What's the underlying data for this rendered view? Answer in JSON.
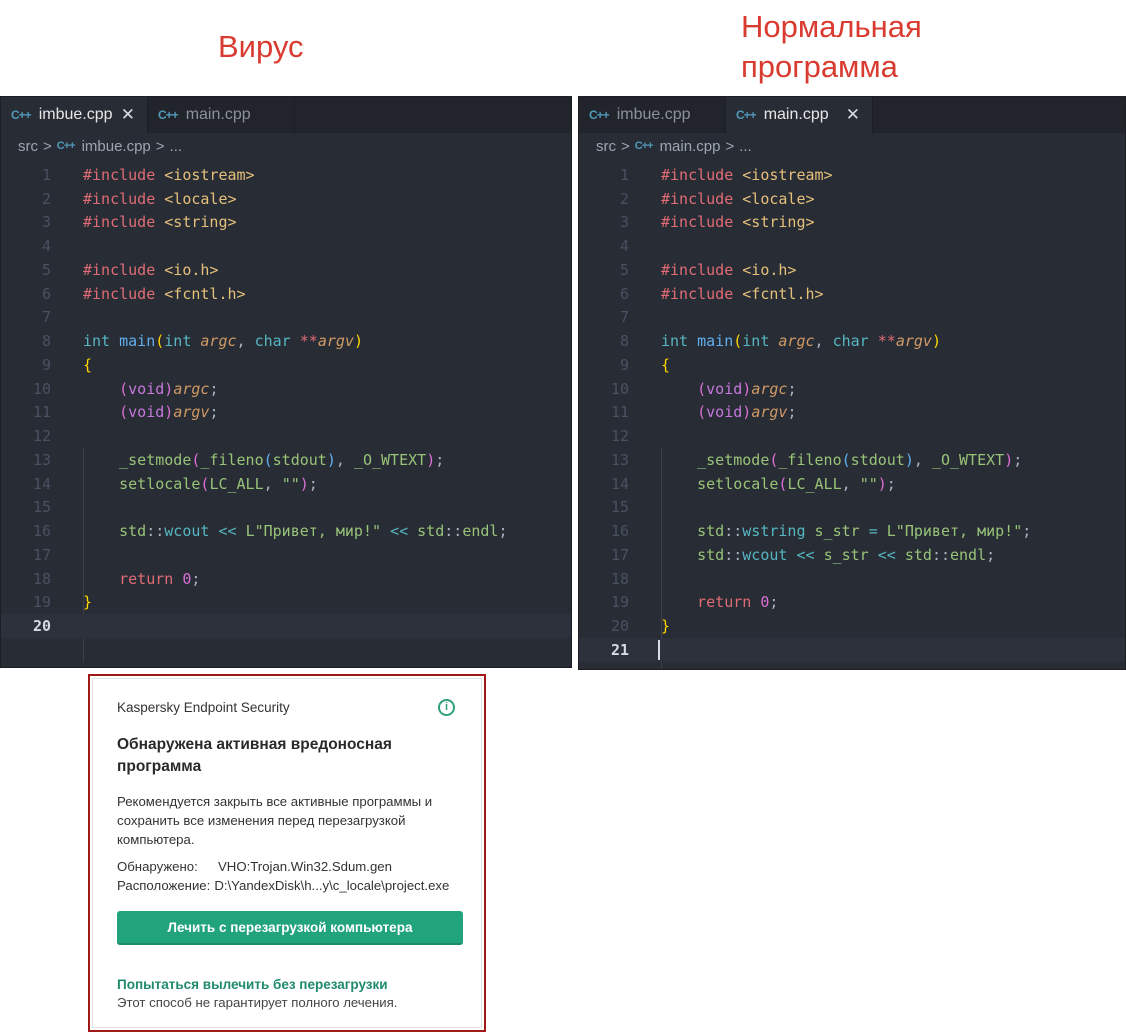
{
  "captions": {
    "left": "Вирус",
    "right": "Нормальная\nпрограмма"
  },
  "icons": {
    "cpp": "C++ file icon",
    "chevron": "chevron-right",
    "info": "info-circle"
  },
  "colors": {
    "accent_caption": "#d93b30",
    "editor_bg": "#282c34",
    "kaspersky_green": "#21a37c",
    "dialog_border": "#a01818"
  },
  "editor_left": {
    "tabs": [
      {
        "label": "imbue.cpp",
        "icon_text": "C++",
        "active": true,
        "close": "✕"
      },
      {
        "label": "main.cpp",
        "icon_text": "C++",
        "active": false
      }
    ],
    "breadcrumb": {
      "folder": "src",
      "sep": ">",
      "file": "imbue.cpp",
      "tail": "..."
    },
    "current_line": 20
  },
  "editor_right": {
    "tabs": [
      {
        "label": "imbue.cpp",
        "icon_text": "C++",
        "active": false
      },
      {
        "label": "main.cpp",
        "icon_text": "C++",
        "active": true,
        "close": "✕"
      }
    ],
    "breadcrumb": {
      "folder": "src",
      "sep": ">",
      "file": "main.cpp",
      "tail": "..."
    },
    "current_line": 21
  },
  "kaspersky": {
    "app_name": "Kaspersky Endpoint Security",
    "info_glyph": "i",
    "title": "Обнаружена активная вредоносная программа",
    "body": "Рекомендуется закрыть все активные программы и сохранить все изменения перед перезагрузкой компьютера.",
    "detected_label": "Обнаружено:",
    "detected_value": "VHO:Trojan.Win32.Sdum.gen",
    "location_label": "Расположение:",
    "location_value": "D:\\YandexDisk\\h...y\\c_locale\\project.exe",
    "primary_button": "Лечить с перезагрузкой компьютера",
    "link": "Попытаться вылечить без перезагрузки",
    "note": "Этот способ не гарантирует полного лечения."
  }
}
